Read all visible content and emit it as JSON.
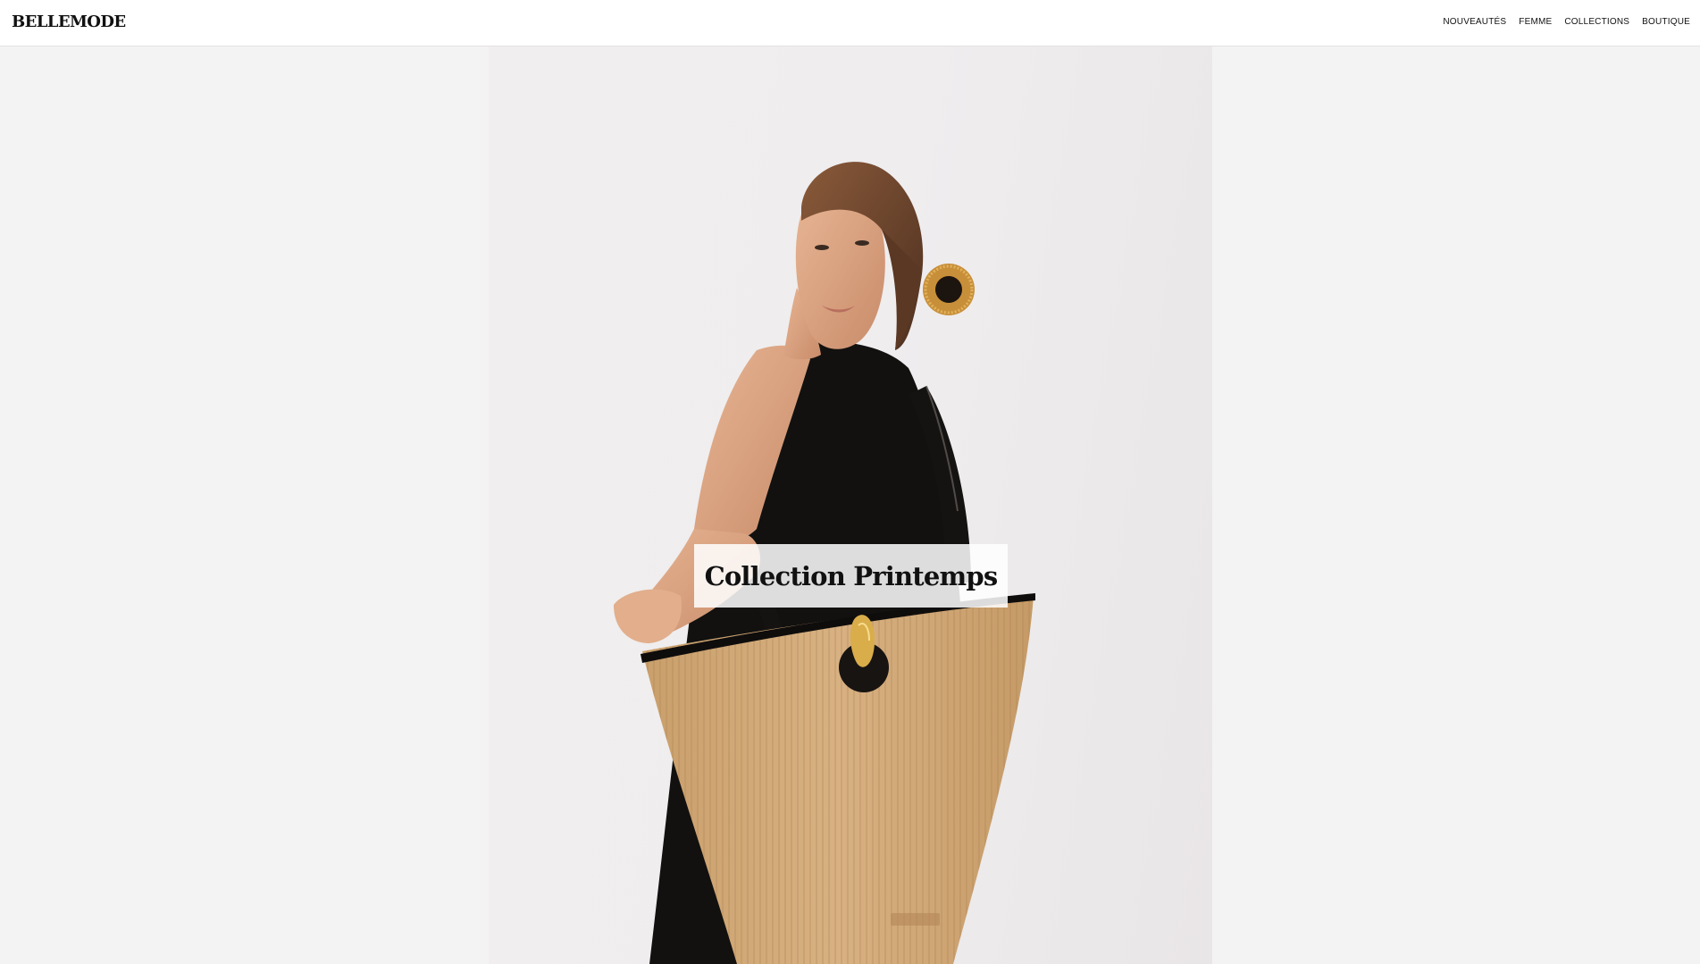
{
  "header": {
    "logo": "BELLEMODE",
    "nav": [
      {
        "label": "NOUVEAUTÉS"
      },
      {
        "label": "FEMME"
      },
      {
        "label": "COLLECTIONS"
      },
      {
        "label": "BOUTIQUE"
      }
    ]
  },
  "hero": {
    "title": "Collection Printemps"
  },
  "colors": {
    "background": "#f4f3f3",
    "header_bg": "#ffffff",
    "text": "#111111",
    "straw": "#d1a977",
    "dress": "#121110"
  }
}
